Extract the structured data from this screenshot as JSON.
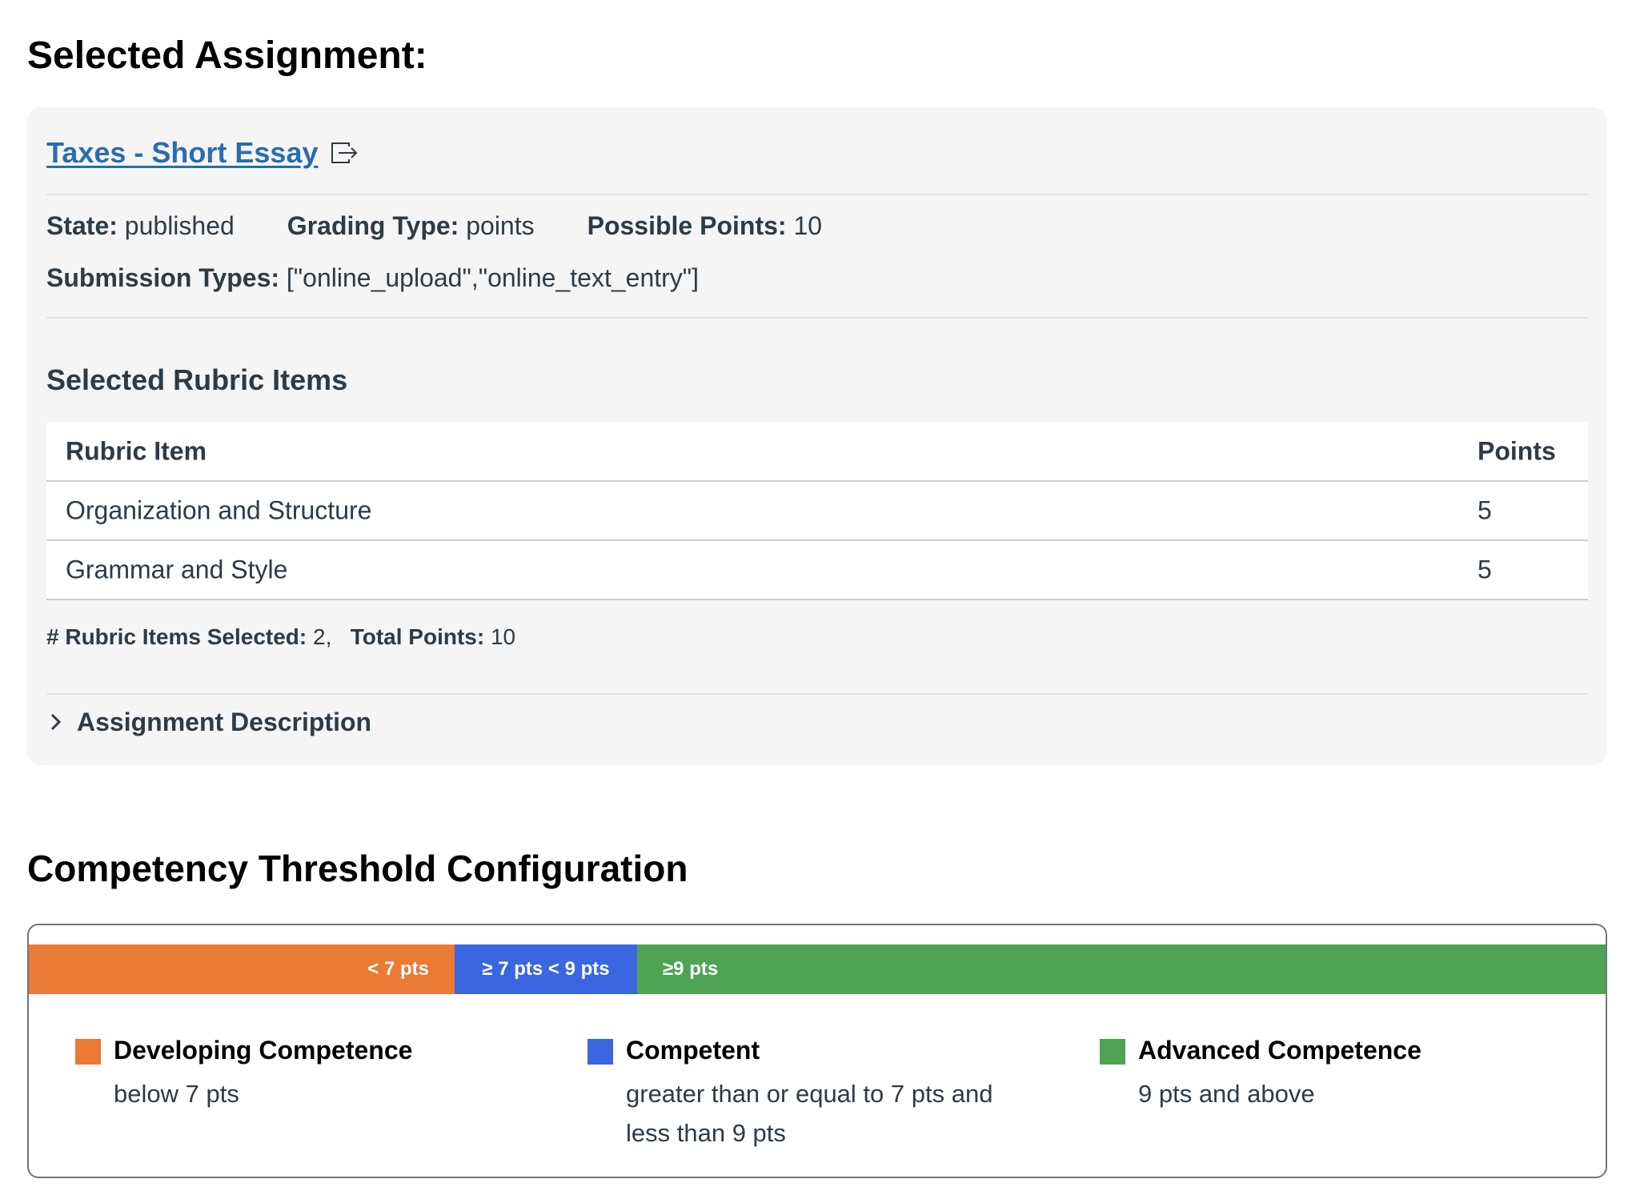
{
  "page": {
    "selected_title": "Selected Assignment:",
    "competency_title": "Competency Threshold Configuration"
  },
  "assignment": {
    "name": "Taxes - Short Essay",
    "link_icon": "external-link-icon",
    "state_label": "State:",
    "state_value": "published",
    "grading_type_label": "Grading Type:",
    "grading_type_value": "points",
    "possible_points_label": "Possible Points:",
    "possible_points_value": "10",
    "submission_types_label": "Submission Types:",
    "submission_types_value": "[\"online_upload\",\"online_text_entry\"]"
  },
  "rubric": {
    "heading": "Selected Rubric Items",
    "columns": {
      "item": "Rubric Item",
      "points": "Points"
    },
    "rows": [
      {
        "item": "Organization and Structure",
        "points": "5"
      },
      {
        "item": "Grammar and Style",
        "points": "5"
      }
    ],
    "selected_count_label": "# Rubric Items Selected:",
    "selected_count_value": "2,",
    "total_points_label": "Total Points:",
    "total_points_value": "10"
  },
  "description": {
    "label": "Assignment Description",
    "icon": "chevron-right-icon",
    "expanded": false
  },
  "thresholds": {
    "bar": {
      "developing": "< 7 pts",
      "competent": "≥ 7 pts < 9 pts",
      "advanced": "≥9 pts"
    },
    "legend": [
      {
        "name": "Developing Competence",
        "desc": "below 7 pts",
        "color": "#ea7a34"
      },
      {
        "name": "Competent",
        "desc": "greater than or equal to 7 pts and less than 9 pts",
        "color": "#3a66e0"
      },
      {
        "name": "Advanced Competence",
        "desc": "9 pts and above",
        "color": "#4ea354"
      }
    ]
  },
  "colors": {
    "link": "#2b6cb0",
    "card_bg": "#f5f5f5",
    "developing": "#ea7a34",
    "competent": "#3a66e0",
    "advanced": "#4ea354"
  }
}
